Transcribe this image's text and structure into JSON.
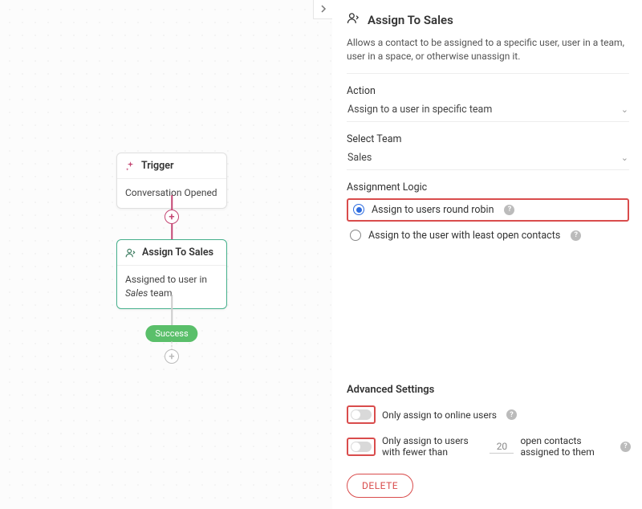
{
  "canvas": {
    "trigger": {
      "title": "Trigger",
      "body": "Conversation Opened"
    },
    "assign_node": {
      "title": "Assign To Sales",
      "body_prefix": "Assigned to user in ",
      "body_team": "Sales",
      "body_suffix": " team"
    },
    "success": "Success"
  },
  "panel": {
    "title": "Assign To Sales",
    "description": "Allows a contact to be assigned to a specific user, user in a team, user in a space, or otherwise unassign it.",
    "action": {
      "label": "Action",
      "value": "Assign to a user in specific team"
    },
    "team": {
      "label": "Select Team",
      "value": "Sales"
    },
    "logic": {
      "label": "Assignment Logic",
      "opt1": "Assign to users round robin",
      "opt2": "Assign to the user with least open contacts"
    },
    "advanced": {
      "title": "Advanced Settings",
      "opt1": "Only assign to online users",
      "opt2_prefix": "Only assign to users with fewer than",
      "opt2_value": "20",
      "opt2_suffix": "open contacts assigned to them"
    },
    "delete": "DELETE"
  }
}
